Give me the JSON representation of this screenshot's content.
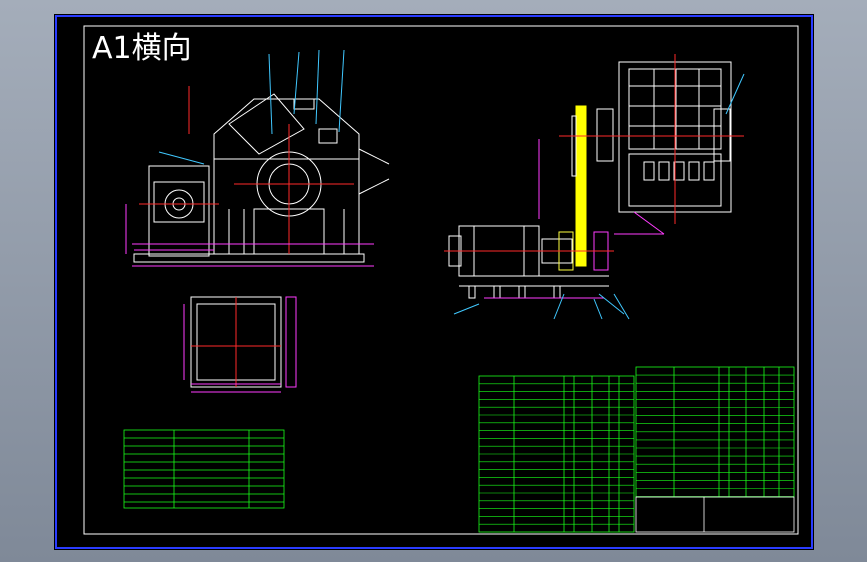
{
  "drawing": {
    "title": "A1横向"
  },
  "colors": {
    "background": "#000000",
    "frame": "#ffffff",
    "outer_frame": "#2a3cff",
    "outline": "#ffffff",
    "centerline": "#ff2a2a",
    "dimension": "#ff3cff",
    "leader": "#40c8ff",
    "table_lines": "#19ff19",
    "table_text": "#ffffff",
    "highlight": "#ffff00",
    "structure": "#ffff40"
  },
  "icons": {
    "front_view": "crusher-front-view-drawing",
    "side_view": "crusher-side-view-drawing",
    "detail_view": "grate-detail-drawing",
    "tech_table": "technical-parameter-table",
    "parts_table": "parts-list-table"
  }
}
